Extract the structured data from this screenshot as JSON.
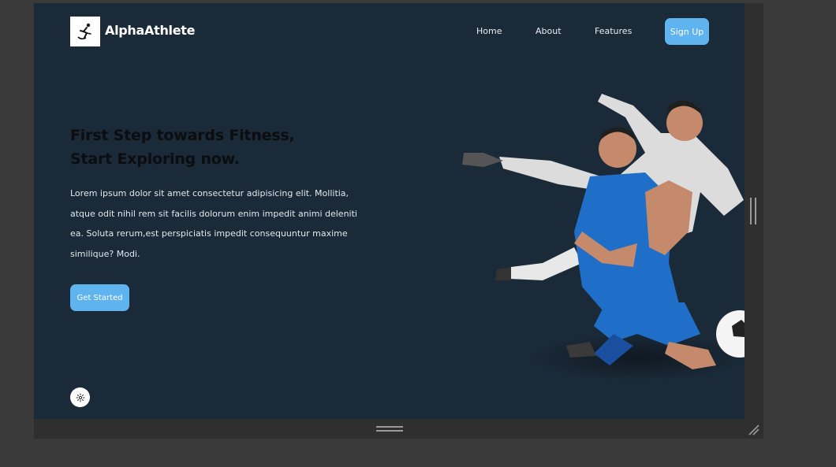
{
  "brand": {
    "name": "AlphaAthlete",
    "logo_icon": "runner-logo-icon"
  },
  "nav": {
    "links": [
      {
        "label": "Home"
      },
      {
        "label": "About"
      },
      {
        "label": "Features"
      }
    ],
    "signup_label": "Sign Up"
  },
  "hero": {
    "headline_line1": "First Step towards Fitness,",
    "headline_line2": "Start Exploring now.",
    "paragraph": "Lorem ipsum dolor sit amet consectetur adipisicing elit. Mollitia, atque odit nihil rem sit facilis dolorum enim impedit animi deleniti ea. Soluta rerum,est perspiciatis impedit consequuntur maxime similique? Modi.",
    "cta_label": "Get Started",
    "image_icon": "soccer-players-illustration"
  },
  "settings": {
    "icon": "gear-icon"
  },
  "colors": {
    "background": "#1b2a38",
    "accent": "#5fb3ef",
    "headline": "#0b0d10",
    "text": "#e3e8ee"
  }
}
